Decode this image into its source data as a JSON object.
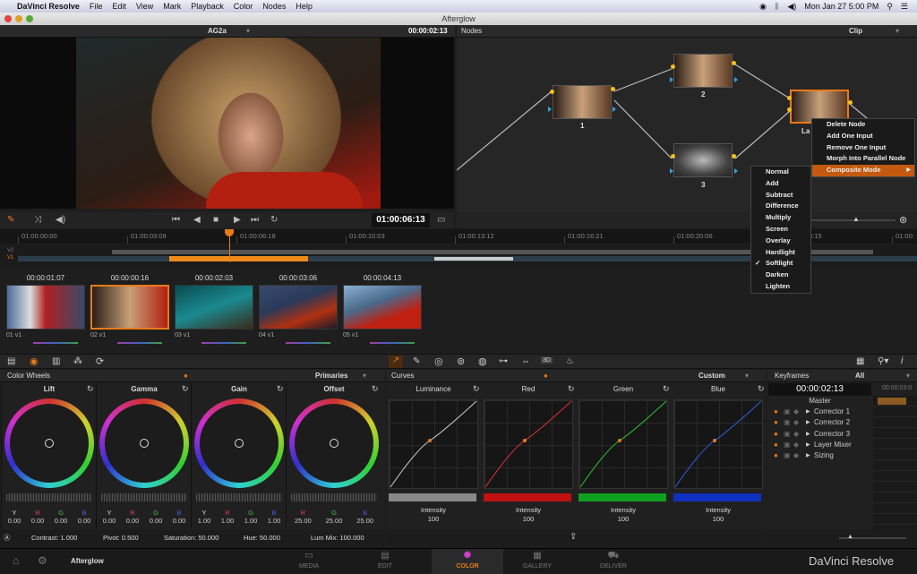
{
  "menubar": {
    "apple": "",
    "app": "DaVinci Resolve",
    "items": [
      "File",
      "Edit",
      "View",
      "Mark",
      "Playback",
      "Color",
      "Nodes",
      "Help"
    ],
    "clock": "Mon Jan 27  5:00 PM"
  },
  "window": {
    "title": "Afterglow"
  },
  "viewer": {
    "clip_name": "AG2a",
    "timecode": "00:00:02:13",
    "transport_timecode": "01:00:06:13"
  },
  "nodes": {
    "title": "Nodes",
    "mode": "Clip",
    "labels": [
      "1",
      "2",
      "3",
      "La"
    ]
  },
  "context_menu": {
    "items": [
      "Delete Node",
      "Add One Input",
      "Remove One Input",
      "Morph Into Parallel Node",
      "Composite Mode"
    ],
    "selected": "Composite Mode"
  },
  "composite_submenu": {
    "items": [
      "Normal",
      "Add",
      "Subtract",
      "Difference",
      "Multiply",
      "Screen",
      "Overlay",
      "Hardlight",
      "Softlight",
      "Darken",
      "Lighten"
    ],
    "checked": "Softlight",
    "check_mark": "✓"
  },
  "timeline": {
    "ticks": [
      "01:00:00:00",
      "01:00:03:09",
      "01:00:06:18",
      "01:00:10:03",
      "01:00:13:12",
      "01:00:16:21",
      "01:00:20:06",
      "01:00:23:15",
      "01:00:"
    ],
    "tracks": [
      "V2",
      "V1"
    ]
  },
  "clips": [
    {
      "tc": "00:00:01:07",
      "name": "01  v1",
      "selected": false
    },
    {
      "tc": "00:00:00:16",
      "name": "02  v1",
      "selected": true
    },
    {
      "tc": "00:00:02:03",
      "name": "03  v1",
      "selected": false
    },
    {
      "tc": "00:00:03:06",
      "name": "04  v1",
      "selected": false
    },
    {
      "tc": "00:00:04:13",
      "name": "05  v1",
      "selected": false
    }
  ],
  "color_wheels": {
    "title": "Color Wheels",
    "mode": "Primaries",
    "wheels": [
      {
        "name": "Lift",
        "labels": [
          "Y",
          "R",
          "G",
          "B"
        ],
        "values": [
          "0.00",
          "0.00",
          "0.00",
          "0.00"
        ]
      },
      {
        "name": "Gamma",
        "labels": [
          "Y",
          "R",
          "G",
          "B"
        ],
        "values": [
          "0.00",
          "0.00",
          "0.00",
          "0.00"
        ]
      },
      {
        "name": "Gain",
        "labels": [
          "Y",
          "R",
          "G",
          "B"
        ],
        "values": [
          "1.00",
          "1.00",
          "1.00",
          "1.00"
        ]
      },
      {
        "name": "Offset",
        "labels": [
          "R",
          "G",
          "B"
        ],
        "values": [
          "25.00",
          "25.00",
          "25.00"
        ]
      }
    ],
    "footer": {
      "contrast": "Contrast: 1.000",
      "pivot": "Pivot: 0.500",
      "saturation": "Saturation: 50.000",
      "hue": "Hue: 50.000",
      "lum_mix": "Lum Mix: 100.000"
    }
  },
  "curves": {
    "title": "Curves",
    "mode": "Custom",
    "channels": [
      {
        "name": "Luminance",
        "color": "#cccccc",
        "bar": "#888888",
        "intensity_label": "Intensity",
        "intensity": "100"
      },
      {
        "name": "Red",
        "color": "#e03030",
        "bar": "#c01010",
        "intensity_label": "Intensity",
        "intensity": "100"
      },
      {
        "name": "Green",
        "color": "#30c030",
        "bar": "#10a020",
        "intensity_label": "Intensity",
        "intensity": "100"
      },
      {
        "name": "Blue",
        "color": "#3060e0",
        "bar": "#1030c0",
        "intensity_label": "Intensity",
        "intensity": "100"
      }
    ]
  },
  "toolbar": {
    "three_d": "3D"
  },
  "keyframes": {
    "title": "Keyframes",
    "filter": "All",
    "timecode": "00:00:02:13",
    "ruler_tc": "00:00:03:0",
    "master": "Master",
    "rows": [
      "Corrector 1",
      "Corrector 2",
      "Corrector 3",
      "Layer Mixer",
      "Sizing"
    ]
  },
  "bottom": {
    "project": "Afterglow",
    "pages": [
      "MEDIA",
      "EDIT",
      "COLOR",
      "GALLERY",
      "DELIVER"
    ],
    "active_page": "COLOR",
    "brand": "DaVinci Resolve"
  },
  "colors": {
    "accent": "#e87a1a",
    "menu_selected": "#c35a10"
  }
}
